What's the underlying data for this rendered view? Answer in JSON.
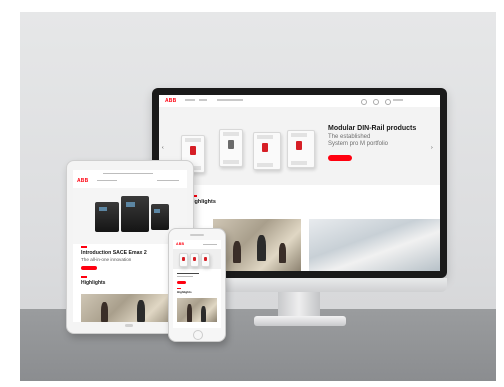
{
  "scene": {
    "description_free": true
  },
  "desktop": {
    "logo": "ABB",
    "hero_title": "Modular DIN-Rail products",
    "hero_subtitle_line1": "The established",
    "hero_subtitle_line2": "System pro M portfolio",
    "hero_button": "",
    "highlights_title": "Highlights"
  },
  "tablet": {
    "logo": "ABB",
    "title": "Introduction SACE Emax 2",
    "subtitle": "The all-in-one innovation",
    "highlights_title": "Highlights"
  },
  "phone": {
    "logo": "ABB",
    "highlights_title": "Highlights"
  },
  "colors": {
    "brand_red": "#ff000f",
    "device_frame": "#1a1a1a",
    "desk": "#8b8d90"
  }
}
